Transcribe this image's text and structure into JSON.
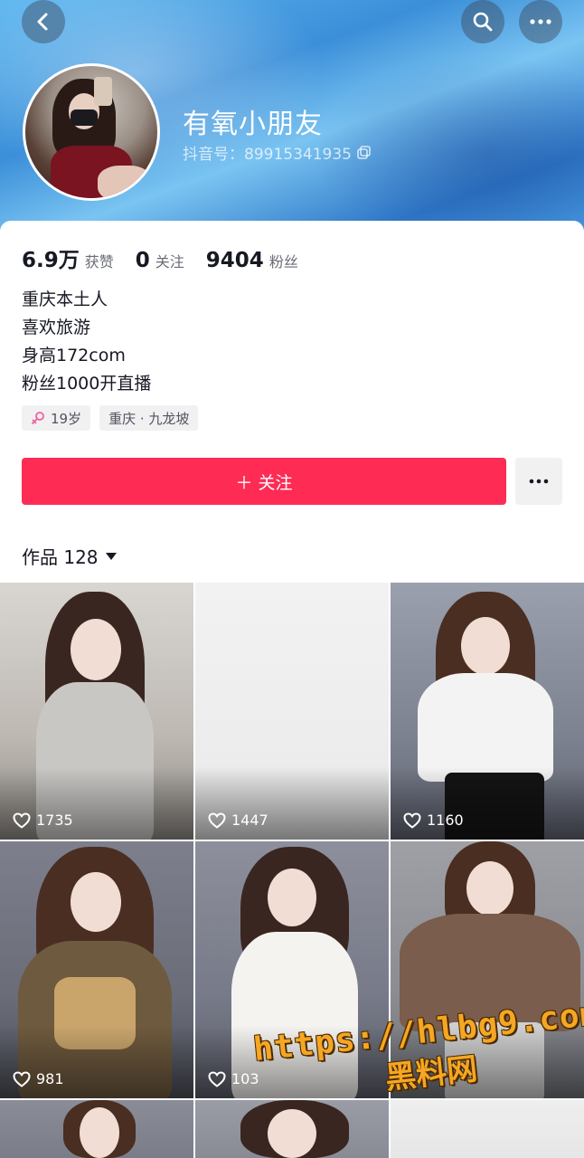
{
  "profile": {
    "nickname": "有氧小朋友",
    "douyin_id": "抖音号：89915341935",
    "stats": {
      "likes": "6.9万",
      "likes_label": "获赞",
      "following": "0",
      "following_label": "关注",
      "followers": "9404",
      "followers_label": "粉丝"
    },
    "bio": [
      "重庆本土人",
      "喜欢旅游",
      "身高172com",
      "粉丝1000开直播"
    ],
    "tags": {
      "age": "19岁",
      "location": "重庆 · 九龙坡"
    },
    "follow_label": "＋ 关注",
    "works_label": "作品 128"
  },
  "grid": {
    "likes": [
      "1735",
      "1447",
      "1160",
      "981",
      "103",
      ""
    ]
  },
  "watermark": {
    "url": "https://hlbg9.com",
    "site": "黑料网"
  },
  "colors": {
    "accent": "#fe2c55",
    "header": "#3b8fd9"
  }
}
